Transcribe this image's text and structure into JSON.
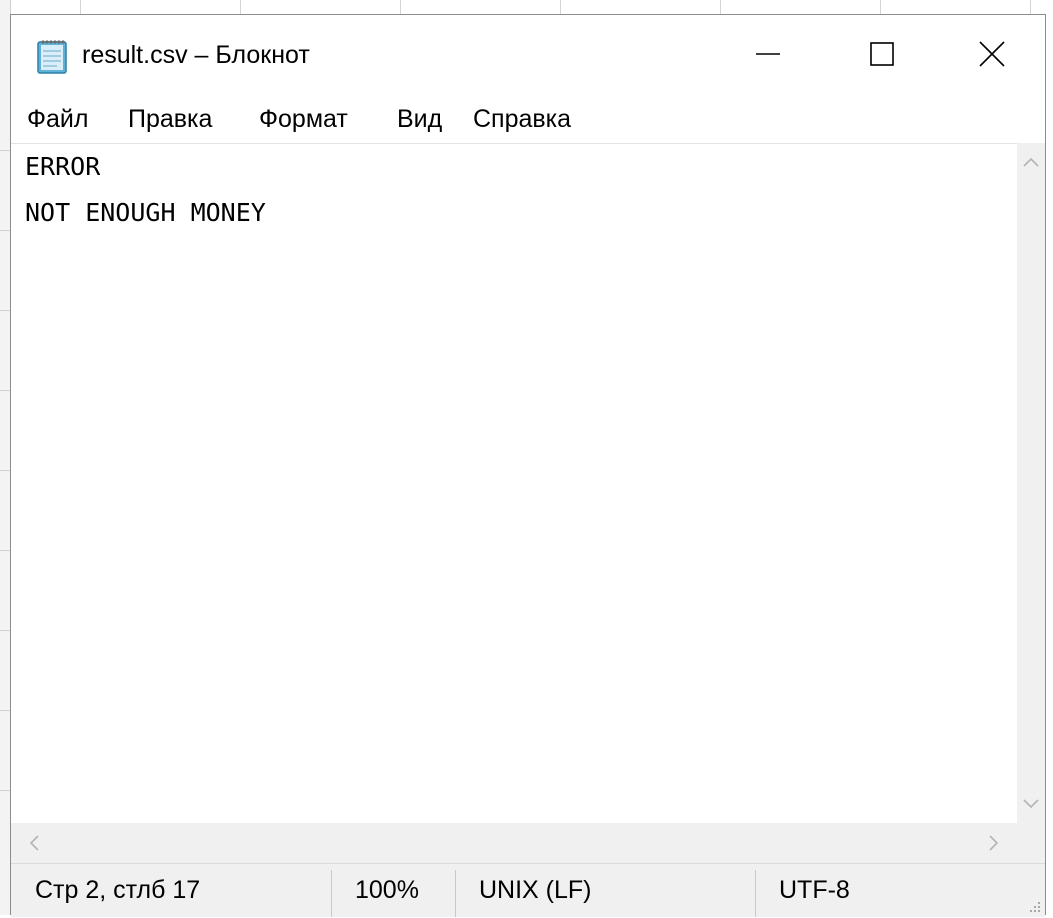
{
  "window": {
    "title": "result.csv – Блокнот"
  },
  "menu": {
    "items": [
      "Файл",
      "Правка",
      "Формат",
      "Вид",
      "Справка"
    ]
  },
  "editor": {
    "lines": [
      "ERROR",
      "NOT ENOUGH MONEY"
    ]
  },
  "status": {
    "position": "Стр 2, стлб 17",
    "zoom": "100%",
    "line_ending": "UNIX (LF)",
    "encoding": "UTF-8"
  },
  "icons": {
    "app": "notepad-icon",
    "minimize": "minimize-icon",
    "maximize": "maximize-icon",
    "close": "close-icon"
  }
}
